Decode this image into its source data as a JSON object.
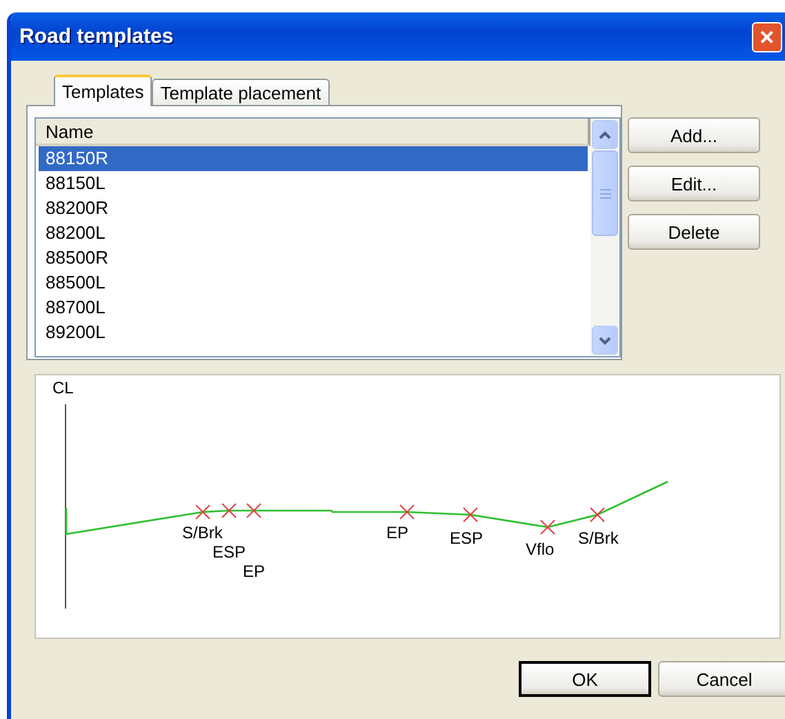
{
  "window": {
    "title": "Road templates",
    "close": "✕"
  },
  "tabs": [
    {
      "label": "Templates",
      "selected": true
    },
    {
      "label": "Template placement",
      "selected": false
    }
  ],
  "list": {
    "column": "Name",
    "items": [
      {
        "label": "88150R",
        "selected": true
      },
      {
        "label": "88150L",
        "selected": false
      },
      {
        "label": "88200R",
        "selected": false
      },
      {
        "label": "88200L",
        "selected": false
      },
      {
        "label": "88500R",
        "selected": false
      },
      {
        "label": "88500L",
        "selected": false
      },
      {
        "label": "88700L",
        "selected": false
      },
      {
        "label": "89200L",
        "selected": false
      }
    ]
  },
  "side_buttons": [
    "Add...",
    "Edit...",
    "Delete"
  ],
  "profile": {
    "axis_label": "CL",
    "points": [
      {
        "label": "S/Brk"
      },
      {
        "label": "ESP"
      },
      {
        "label": "EP"
      },
      {
        "label": "EP"
      },
      {
        "label": "ESP"
      },
      {
        "label": "Vflo"
      },
      {
        "label": "S/Brk"
      }
    ]
  },
  "buttons": [
    {
      "label": "OK",
      "default": true
    },
    {
      "label": "Cancel",
      "default": false
    }
  ]
}
